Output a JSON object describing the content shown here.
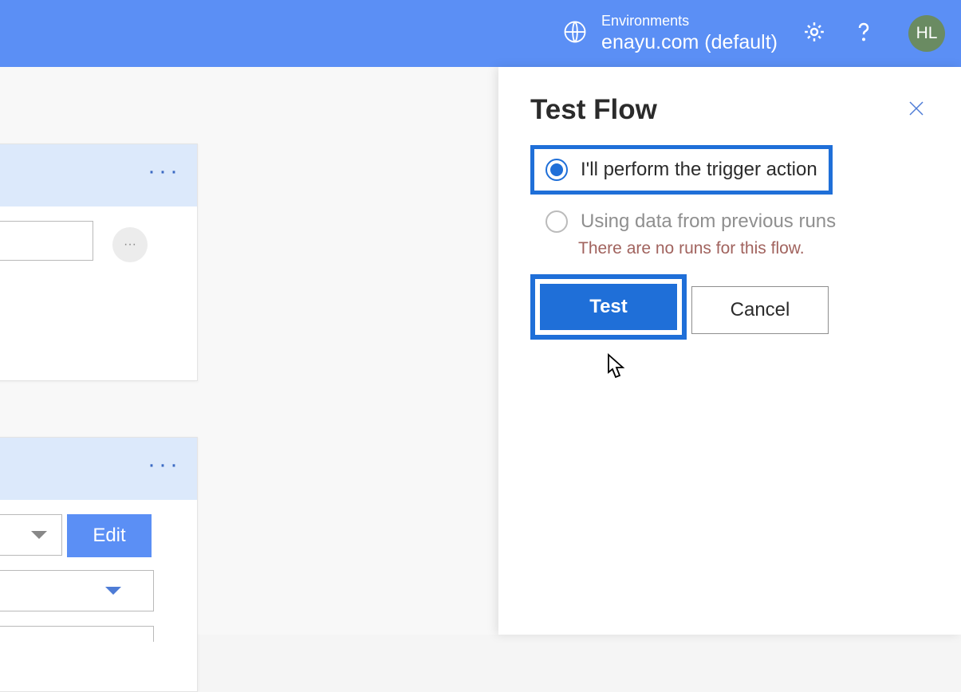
{
  "header": {
    "env_label": "Environments",
    "env_value": "enayu.com (default)",
    "avatar_initials": "HL"
  },
  "background": {
    "edit_label": "Edit",
    "ellipsis": ". . ."
  },
  "panel": {
    "title": "Test Flow",
    "options": {
      "manual": "I'll perform the trigger action",
      "previous": "Using data from previous runs",
      "previous_helper": "There are no runs for this flow."
    },
    "buttons": {
      "test": "Test",
      "cancel": "Cancel"
    }
  }
}
